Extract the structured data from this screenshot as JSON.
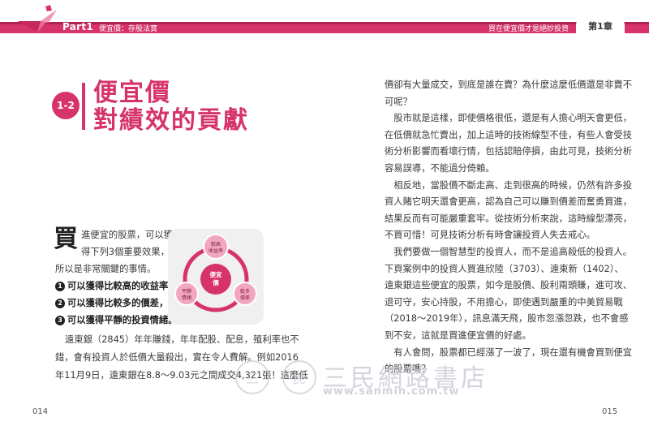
{
  "header": {
    "part_label": "Part1",
    "part_subtitle": "便宜價：存股法寶",
    "book_title": "買在便宜價才是絕妙投資",
    "chapter_tab": "第1章"
  },
  "section": {
    "number": "1-2",
    "title_line1": "便宜價",
    "title_line2": "對績效的貢獻"
  },
  "left_page": {
    "dropcap": "買",
    "intro_line1": "進便宜的股票，可以獲",
    "intro_line2": "得下列3個重要效果，",
    "intro_line3": "所以是非常關鍵的事情。",
    "bullets": [
      {
        "num": "1",
        "text": "可以獲得比較高的收益率，"
      },
      {
        "num": "2",
        "text": "可以獲得比較多的價差，"
      },
      {
        "num": "3",
        "text": "可以獲得平靜的投資情緒。"
      }
    ],
    "paragraph": [
      "遠東銀（2845）年年賺錢，年年配股、配息，殖利率也不",
      "錯，會有投資人於低價大量殺出，實在令人費解。例如2016",
      "年11月9日，遠東銀在8.8～9.03元之間成交4,321張！這麼低"
    ],
    "page_number": "014"
  },
  "diagram": {
    "center": "便宜價",
    "top": "較高收益率",
    "right": "較多價差",
    "left": "平靜情緒"
  },
  "right_page": {
    "lines": [
      "價卻有大量成交，到底是誰在賣？為什麼這麼低價還是非賣不",
      "可呢？",
      "　股市就是這樣，即使價格很低，還是有人擔心明天會更低，",
      "在低價就急忙賣出，加上這時的技術線型不佳，有些人會受技",
      "術分析影響而看壞行情，包括認賠停損，由此可見，技術分析",
      "容易誤導，不能過分倚賴。",
      "　相反地，當股價不斷走高、走到很高的時候，仍然有許多投",
      "資人賭它明天還會更高，認為自己可以賺到價差而奮勇買進，",
      "結果反而有可能嚴重套牢。從技術分析來說，這時線型漂亮，",
      "不買可惜！可見技術分析有時會讓投資人失去戒心。",
      "　我們要做一個智慧型的投資人，而不是追高殺低的投資人。",
      "下頁案例中的投資人買進欣陸（3703）、遠東新（1402）、",
      "遠東銀這些便宜的股票，如今是股價、股利兩頭賺，進可攻、",
      "退可守，安心持股，不用擔心，即使遇到嚴重的中美貿易戰",
      "（2018～2019年），訊息滿天飛，股市忽漲忽跌，也不會感",
      "到不安，這就是買進便宜價的好處。",
      "　有人會問，股票都已經漲了一波了，現在還有機會買到便宜",
      "的股票嗎？"
    ],
    "page_number": "015"
  },
  "watermark": {
    "circle1": "三",
    "circle2": "民",
    "text": "三民網路書店",
    "url": "www.sanmin.com.tw"
  },
  "colors": {
    "accent": "#d6336c"
  }
}
